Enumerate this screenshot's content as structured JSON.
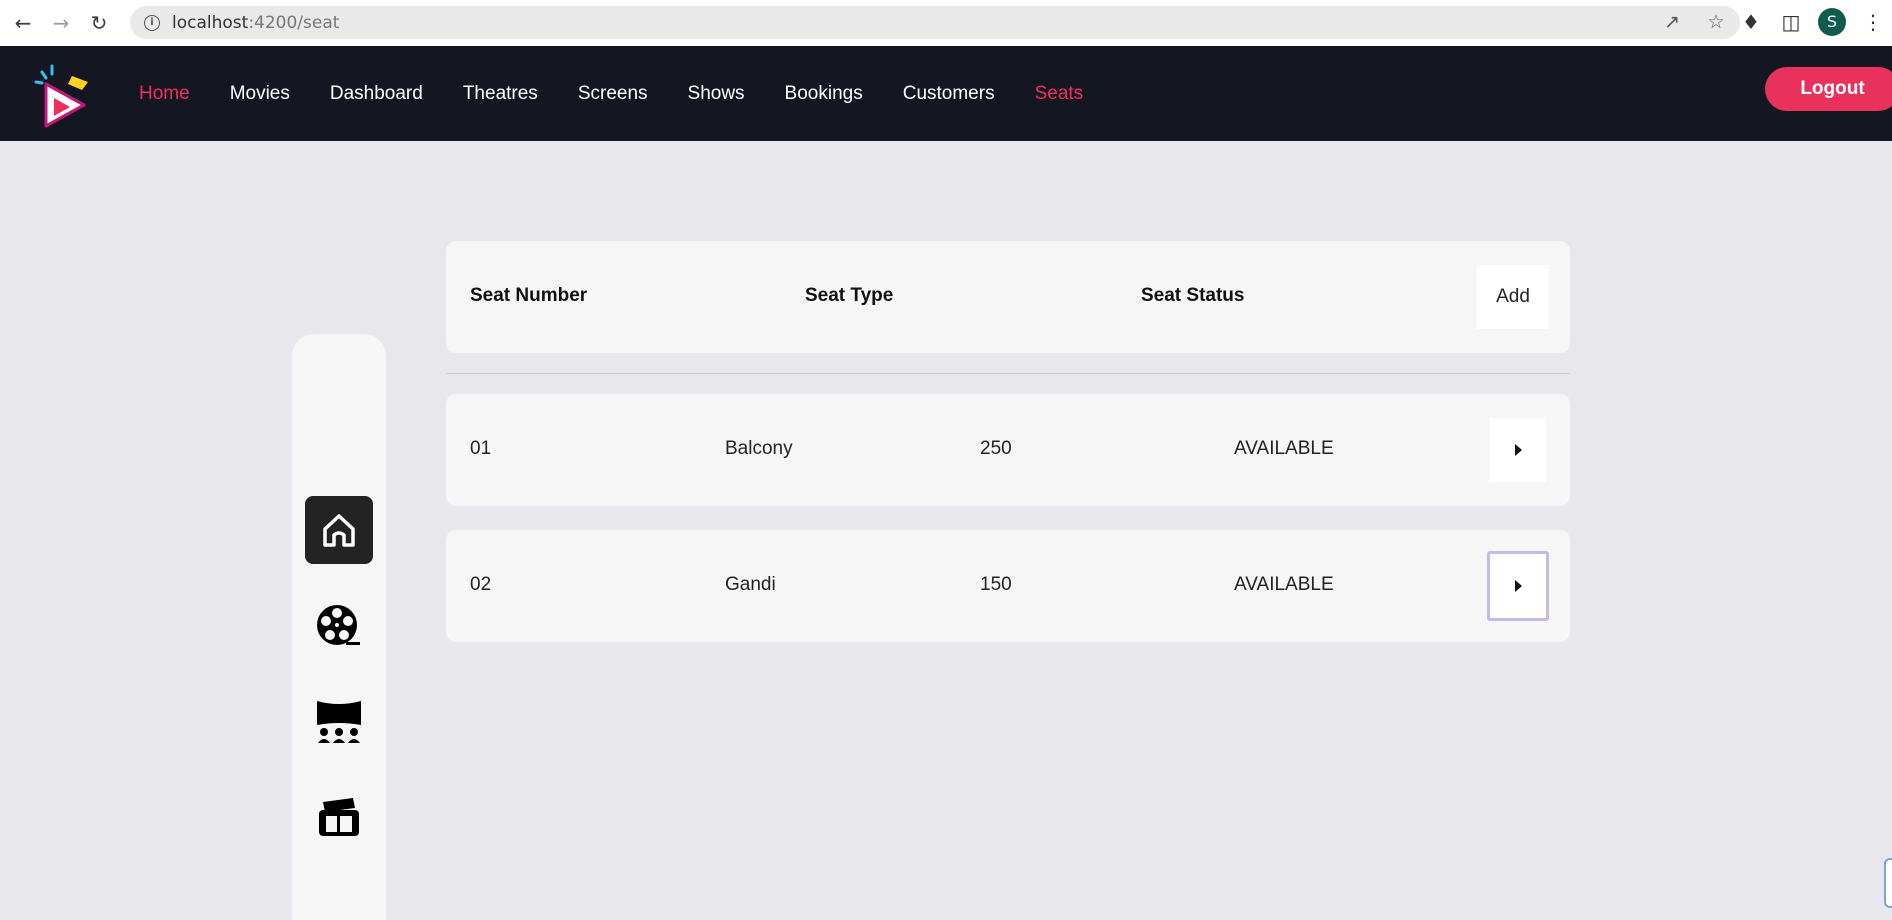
{
  "browser": {
    "url_host": "localhost",
    "url_rest": ":4200/seat",
    "avatar_letter": "S"
  },
  "navbar": {
    "links": [
      "Home",
      "Movies",
      "Dashboard",
      "Theatres",
      "Screens",
      "Shows",
      "Bookings",
      "Customers",
      "Seats"
    ],
    "logout_label": "Logout",
    "accent_color": "#ef2f5b"
  },
  "sidebar": {
    "items": [
      {
        "icon": "home-icon",
        "active": true
      },
      {
        "icon": "film-reel-icon",
        "active": false
      },
      {
        "icon": "theatre-screen-icon",
        "active": false
      },
      {
        "icon": "tickets-icon",
        "active": false
      }
    ]
  },
  "table": {
    "headers": {
      "seat_number": "Seat Number",
      "seat_type": "Seat Type",
      "seat_status": "Seat Status"
    },
    "add_label": "Add",
    "rows": [
      {
        "number": "01",
        "type": "Balcony",
        "price": "250",
        "status": "AVAILABLE"
      },
      {
        "number": "02",
        "type": "Gandi",
        "price": "150",
        "status": "AVAILABLE"
      }
    ]
  }
}
